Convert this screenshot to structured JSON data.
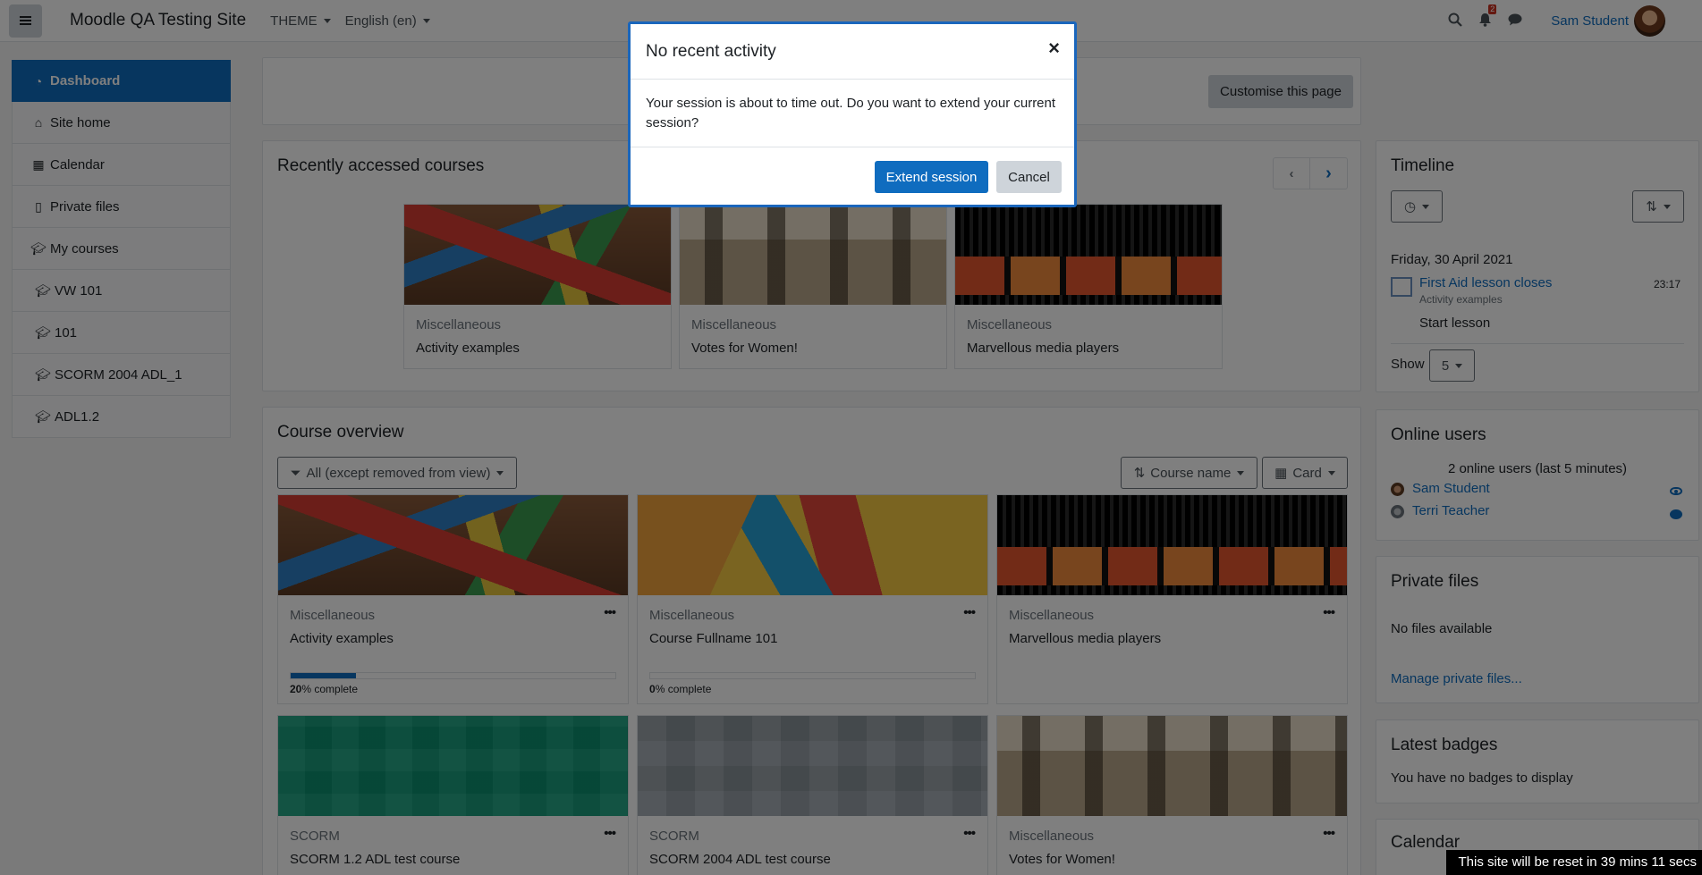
{
  "navbar": {
    "site_name": "Moodle QA Testing Site",
    "theme_menu": "THEME",
    "language_menu": "English (en)",
    "notification_count": "2",
    "user_name": "Sam Student",
    "icons": [
      "bars-icon",
      "search-icon",
      "bell-icon",
      "comment-icon"
    ]
  },
  "drawer": {
    "items": [
      {
        "label": "Dashboard",
        "icon": "tachometer-icon",
        "active": true
      },
      {
        "label": "Site home",
        "icon": "home-icon"
      },
      {
        "label": "Calendar",
        "icon": "calendar-icon"
      },
      {
        "label": "Private files",
        "icon": "file-icon"
      },
      {
        "label": "My courses",
        "icon": "graduation-cap-icon"
      },
      {
        "label": "VW 101",
        "icon": "graduation-cap-icon"
      },
      {
        "label": "101",
        "icon": "graduation-cap-icon"
      },
      {
        "label": "SCORM 2004 ADL_1",
        "icon": "graduation-cap-icon"
      },
      {
        "label": "ADL1.2",
        "icon": "graduation-cap-icon"
      }
    ]
  },
  "page": {
    "customise_button": "Customise this page"
  },
  "recent_courses": {
    "title": "Recently accessed courses",
    "items": [
      {
        "category": "Miscellaneous",
        "name": "Activity examples"
      },
      {
        "category": "Miscellaneous",
        "name": "Votes for Women!"
      },
      {
        "category": "Miscellaneous",
        "name": "Marvellous media players"
      }
    ]
  },
  "course_overview": {
    "title": "Course overview",
    "filter": "All (except removed from view)",
    "sort": "Course name",
    "view": "Card",
    "courses": [
      {
        "category": "Miscellaneous",
        "name": "Activity examples",
        "progress_percent": 20,
        "progress_value": "20",
        "progress_suffix": "% complete"
      },
      {
        "category": "Miscellaneous",
        "name": "Course Fullname 101",
        "progress_percent": 0,
        "progress_value": "0",
        "progress_suffix": "% complete"
      },
      {
        "category": "Miscellaneous",
        "name": "Marvellous media players"
      },
      {
        "category": "SCORM",
        "name": "SCORM 1.2 ADL test course"
      },
      {
        "category": "SCORM",
        "name": "SCORM 2004 ADL test course"
      },
      {
        "category": "Miscellaneous",
        "name": "Votes for Women!"
      }
    ]
  },
  "timeline": {
    "title": "Timeline",
    "date": "Friday, 30 April 2021",
    "event_name": "First Aid lesson closes",
    "event_course": "Activity examples",
    "event_time": "23:17",
    "event_action": "Start lesson",
    "show_label": "Show",
    "show_value": "5"
  },
  "online_users": {
    "title": "Online users",
    "summary": "2 online users (last 5 minutes)",
    "users": [
      "Sam Student",
      "Terri Teacher"
    ]
  },
  "private_files": {
    "title": "Private files",
    "empty": "No files available",
    "manage_link": "Manage private files..."
  },
  "latest_badges": {
    "title": "Latest badges",
    "empty": "You have no badges to display"
  },
  "calendar": {
    "title": "Calendar"
  },
  "modal": {
    "title": "No recent activity",
    "close": "×",
    "body": "Your session is about to time out. Do you want to extend your current session?",
    "extend_button": "Extend session",
    "cancel_button": "Cancel"
  },
  "footer": {
    "reset_notice": "This site will be reset in 39 mins 11 secs"
  },
  "colors": {
    "primary": "#0f6cbf",
    "backdrop": "rgba(0,0,0,0.5)",
    "modal_border": "#1a66bc"
  }
}
